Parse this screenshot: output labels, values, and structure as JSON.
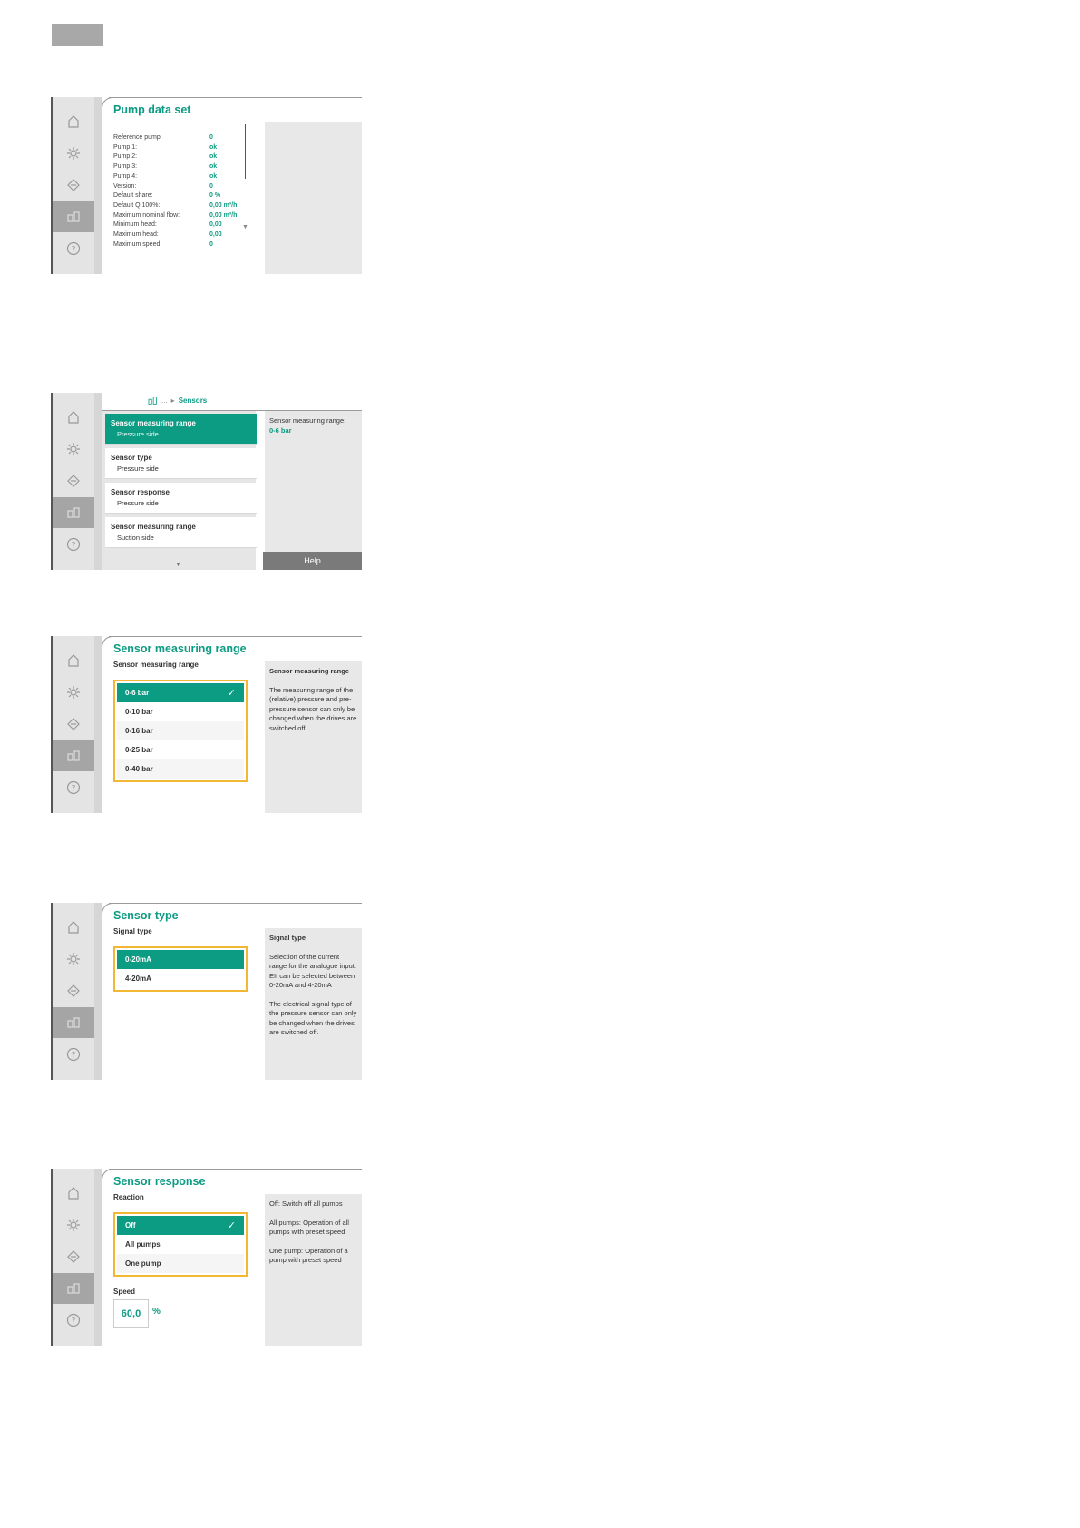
{
  "screens": {
    "pump_data_set": {
      "title": "Pump data set",
      "rows": [
        {
          "label": "Reference pump:",
          "value": "0"
        },
        {
          "label": "Pump 1:",
          "value": "ok"
        },
        {
          "label": "Pump 2:",
          "value": "ok"
        },
        {
          "label": "Pump 3:",
          "value": "ok"
        },
        {
          "label": "Pump 4:",
          "value": "ok"
        },
        {
          "label": "Version:",
          "value": "0"
        },
        {
          "label": "Default share:",
          "value": "0 %"
        },
        {
          "label": "Default Q 100%:",
          "value": "0,00 m³/h"
        },
        {
          "label": "Maximum nominal flow:",
          "value": "0,00 m³/h"
        },
        {
          "label": "Minimum head:",
          "value": "0,00"
        },
        {
          "label": "Maximum head:",
          "value": "0,00"
        },
        {
          "label": "Maximum speed:",
          "value": "0"
        }
      ]
    },
    "sensors": {
      "breadcrumb": {
        "ellipsis": "...",
        "current": "Sensors"
      },
      "items": [
        {
          "title": "Sensor measuring range",
          "sub": "Pressure side"
        },
        {
          "title": "Sensor type",
          "sub": "Pressure side"
        },
        {
          "title": "Sensor response",
          "sub": "Pressure side"
        },
        {
          "title": "Sensor measuring range",
          "sub": "Suction side"
        }
      ],
      "help": {
        "label": "Sensor measuring range:",
        "value": "0-6 bar",
        "button": "Help"
      }
    },
    "measuring_range": {
      "title": "Sensor measuring range",
      "subtitle": "Sensor measuring range",
      "options": [
        "0-6 bar",
        "0-10 bar",
        "0-16 bar",
        "0-25 bar",
        "0-40 bar"
      ],
      "selected": "0-6 bar",
      "help_title": "Sensor measuring range",
      "help_text": "The measuring range of the (relative) pressure and pre-pressure sensor can only be changed when the drives are switched off."
    },
    "sensor_type": {
      "title": "Sensor type",
      "subtitle": "Signal type",
      "options": [
        "0-20mA",
        "4-20mA"
      ],
      "selected": "0-20mA",
      "help_title": "Signal type",
      "help_p1": "Selection of the current range for the analogue input.",
      "help_p2": "EIt can be selected between 0-20mA and 4-20mA",
      "help_p3": "The electrical signal type of the pressure sensor can only be changed when the drives are switched off."
    },
    "sensor_response": {
      "title": "Sensor response",
      "subtitle": "Reaction",
      "options": [
        "Off",
        "All pumps",
        "One pump"
      ],
      "selected": "Off",
      "speed_label": "Speed",
      "speed_value": "60,0",
      "speed_unit": "%",
      "help_p1": "Off: Switch off all pumps",
      "help_p2": "All pumps: Operation of all pumps with preset speed",
      "help_p3": "One pump: Operation of a pump with preset speed"
    }
  },
  "colors": {
    "accent": "#0c9b83",
    "highlight": "#f2b733",
    "panel": "#e8e8e8"
  },
  "icons": [
    "home-icon",
    "gear-icon",
    "diagnostics-icon",
    "pumps-icon",
    "help-icon"
  ]
}
